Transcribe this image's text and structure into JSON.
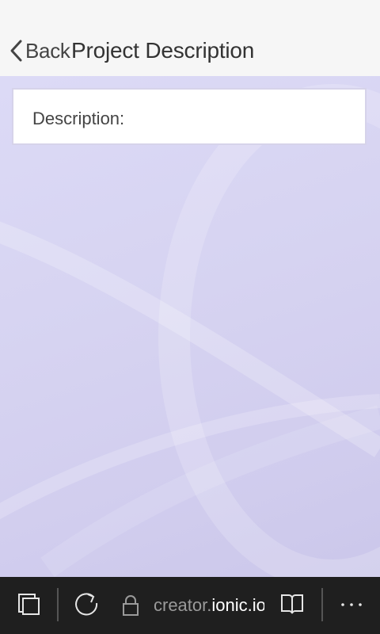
{
  "header": {
    "back_label": "Back",
    "title": "Project Description"
  },
  "card": {
    "label": "Description:"
  },
  "browser_bar": {
    "url_prefix": "creator.",
    "url_domain": "ionic.io",
    "icons": [
      "tabs-icon",
      "refresh-icon",
      "lock-icon",
      "reading-view-icon",
      "more-icon"
    ]
  },
  "colors": {
    "header_bg": "#f6f6f6",
    "content_bg": "#d6d3f1",
    "bar_bg": "#1f1f1f"
  }
}
